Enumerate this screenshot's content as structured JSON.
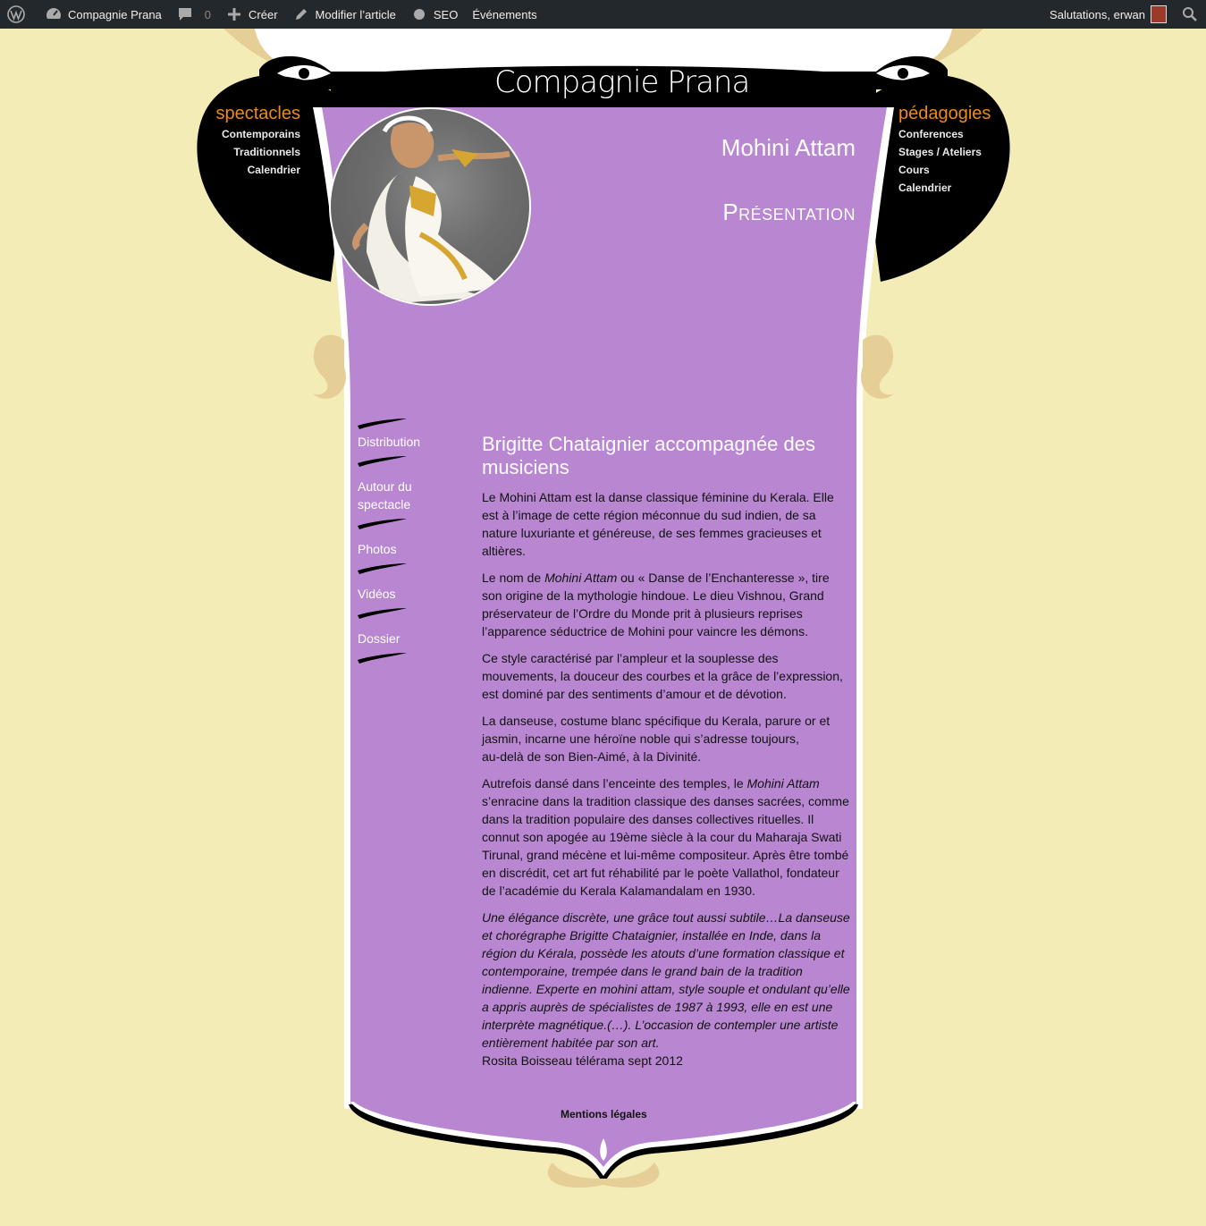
{
  "adminbar": {
    "site_name": "Compagnie Prana",
    "comments_count": "0",
    "new_label": "Créer",
    "edit_label": "Modifier l’article",
    "seo_label": "SEO",
    "events_label": "Événements",
    "greeting": "Salutations, erwan"
  },
  "header": {
    "logo_text": "Compagnie Prana"
  },
  "nav_left": {
    "heading": "spectacles",
    "items": [
      "Contemporains",
      "Traditionnels",
      "Calendrier"
    ]
  },
  "nav_right": {
    "heading": "pédagogies",
    "items": [
      "Conferences",
      "Stages / Ateliers",
      "Cours",
      "Calendrier"
    ]
  },
  "page": {
    "title": "Mohini Attam",
    "section": "Présentation"
  },
  "submenu": {
    "items": [
      "Distribution",
      "Autour du spectacle",
      "Photos",
      "Vidéos",
      "Dossier"
    ]
  },
  "article": {
    "heading": "Brigitte Chataignier accompagnée des musiciens",
    "p1": "Le Mohini Attam est la danse classique féminine du Kerala. Elle est à l’image de cette région méconnue du sud indien, de sa nature luxuriante et généreuse, de ses femmes gracieuses et altières.",
    "p2_a": "Le nom de ",
    "p2_em": "Mohini Attam",
    "p2_b": " ou « Danse de l’Enchanteresse », tire son origine de la mythologie hindoue. Le dieu Vishnou, Grand préservateur de l’Ordre du Monde prit à plusieurs reprises l’apparence séductrice de Mohini pour vaincre les démons.",
    "p3": "Ce style caractérisé par l’ampleur et la souplesse des mouvements, la douceur des courbes et la grâce de l’expression, est dominé par des sentiments d’amour et de dévotion.",
    "p4_line1": "La danseuse, costume blanc spécifique du Kerala, parure or et jasmin, incarne une héroïne noble qui s’adresse toujours,",
    "p4_line2": "au-delà de son Bien-Aimé, à la Divinité.",
    "p5_a": "Autrefois dansé dans l’enceinte des temples, le ",
    "p5_em": "Mohini Attam",
    "p5_b": " s’enracine dans la tradition classique des danses sacrées, comme dans la tradition populaire des danses collectives rituelles. Il connut son apogée au 19ème siècle à la cour du Maharaja Swati Tirunal, grand mécène et lui-même compositeur. Après être tombé en discrédit, cet art fut réhabilité par le poète Vallathol, fondateur de l’académie du Kerala Kalamandalam en 1930.",
    "quote": "Une élégance discrète, une grâce tout aussi subtile…La danseuse et chorégraphe Brigitte Chataignier, installée en Inde, dans la région du Kérala, possède les atouts d’une formation classique et contemporaine, trempée dans le grand bain de la tradition indienne. Experte en mohini attam, style souple et ondulant qu’elle a appris auprès de spécialistes de 1987 à 1993, elle en est une interprète magnétique.(…). L’occasion de contempler une artiste entièrement habitée par son art.",
    "quote_source": "Rosita Boisseau télérama sept 2012"
  },
  "footer": {
    "legal_link": "Mentions légales"
  },
  "colors": {
    "background": "#f3ecb6",
    "panel": "#b987d2",
    "accent": "#f08a12",
    "dark": "#000000",
    "gold": "#e6cf96"
  }
}
